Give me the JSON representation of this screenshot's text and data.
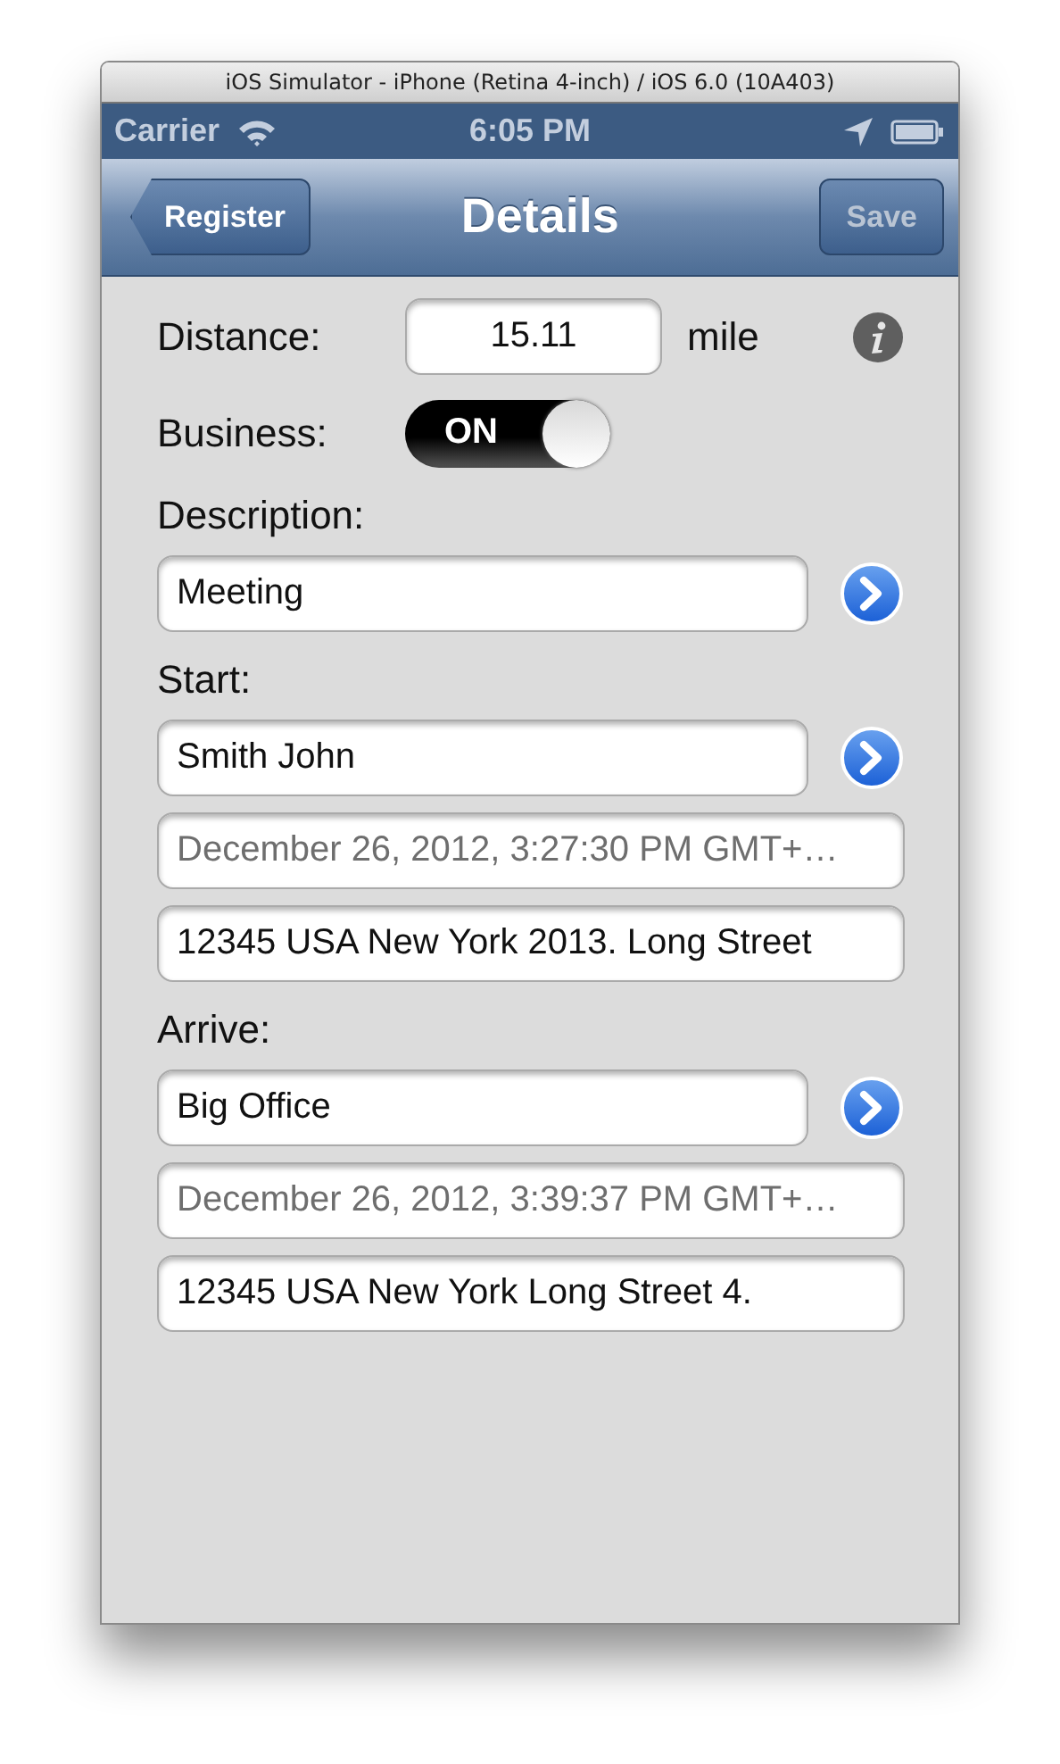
{
  "window": {
    "title": "iOS Simulator - iPhone (Retina 4-inch) / iOS 6.0 (10A403)"
  },
  "status_bar": {
    "carrier": "Carrier",
    "time": "6:05 PM"
  },
  "nav_bar": {
    "back_button": "Register",
    "title": "Details",
    "action_button": {
      "label": "Save",
      "disabled": true
    }
  },
  "distance": {
    "label": "Distance:",
    "value": "15.11",
    "unit": "mile"
  },
  "business": {
    "label": "Business:",
    "on": true,
    "switch_text": "ON"
  },
  "sections": [
    {
      "label": "Description:",
      "fields": [
        {
          "value": "Meeting",
          "disabled": false,
          "detail_button": true
        }
      ]
    },
    {
      "label": "Start:",
      "fields": [
        {
          "value": "Smith John",
          "disabled": false,
          "detail_button": true
        },
        {
          "value": "December 26, 2012, 3:27:30 PM GMT+…",
          "disabled": true,
          "detail_button": false
        },
        {
          "value": "12345 USA New York 2013. Long Street",
          "disabled": false,
          "detail_button": false
        }
      ]
    },
    {
      "label": "Arrive:",
      "fields": [
        {
          "value": "Big Office",
          "disabled": false,
          "detail_button": true
        },
        {
          "value": "December 26, 2012, 3:39:37 PM GMT+…",
          "disabled": true,
          "detail_button": false
        },
        {
          "value": "12345 USA New York Long Street 4.",
          "disabled": false,
          "detail_button": false
        }
      ]
    }
  ]
}
